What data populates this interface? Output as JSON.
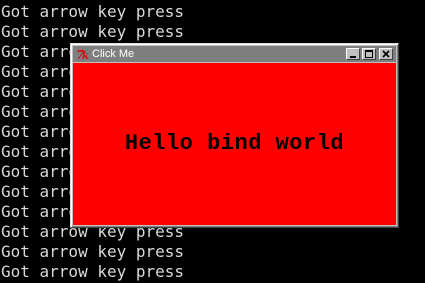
{
  "console": {
    "lines": [
      "Got arrow key press",
      "Got arrow key press",
      "Got arrow key press",
      "Got arrow key press",
      "Got arrow key press",
      "Got arrow key press",
      "Got arrow key press",
      "Got arrow key press",
      "Got arrow key press",
      "Got arrow key press",
      "Got arrow key press",
      "Got arrow key press",
      "Got arrow key press",
      "Got arrow key press"
    ],
    "text_color": "#d9d9d9",
    "background": "#000000"
  },
  "window": {
    "title": "Click Me",
    "icon": "tk-feather-icon",
    "buttons": {
      "minimize": "minimize-icon",
      "maximize": "maximize-icon",
      "close": "close-icon"
    },
    "canvas": {
      "background": "#ff0000",
      "label": "Hello bind world"
    }
  }
}
